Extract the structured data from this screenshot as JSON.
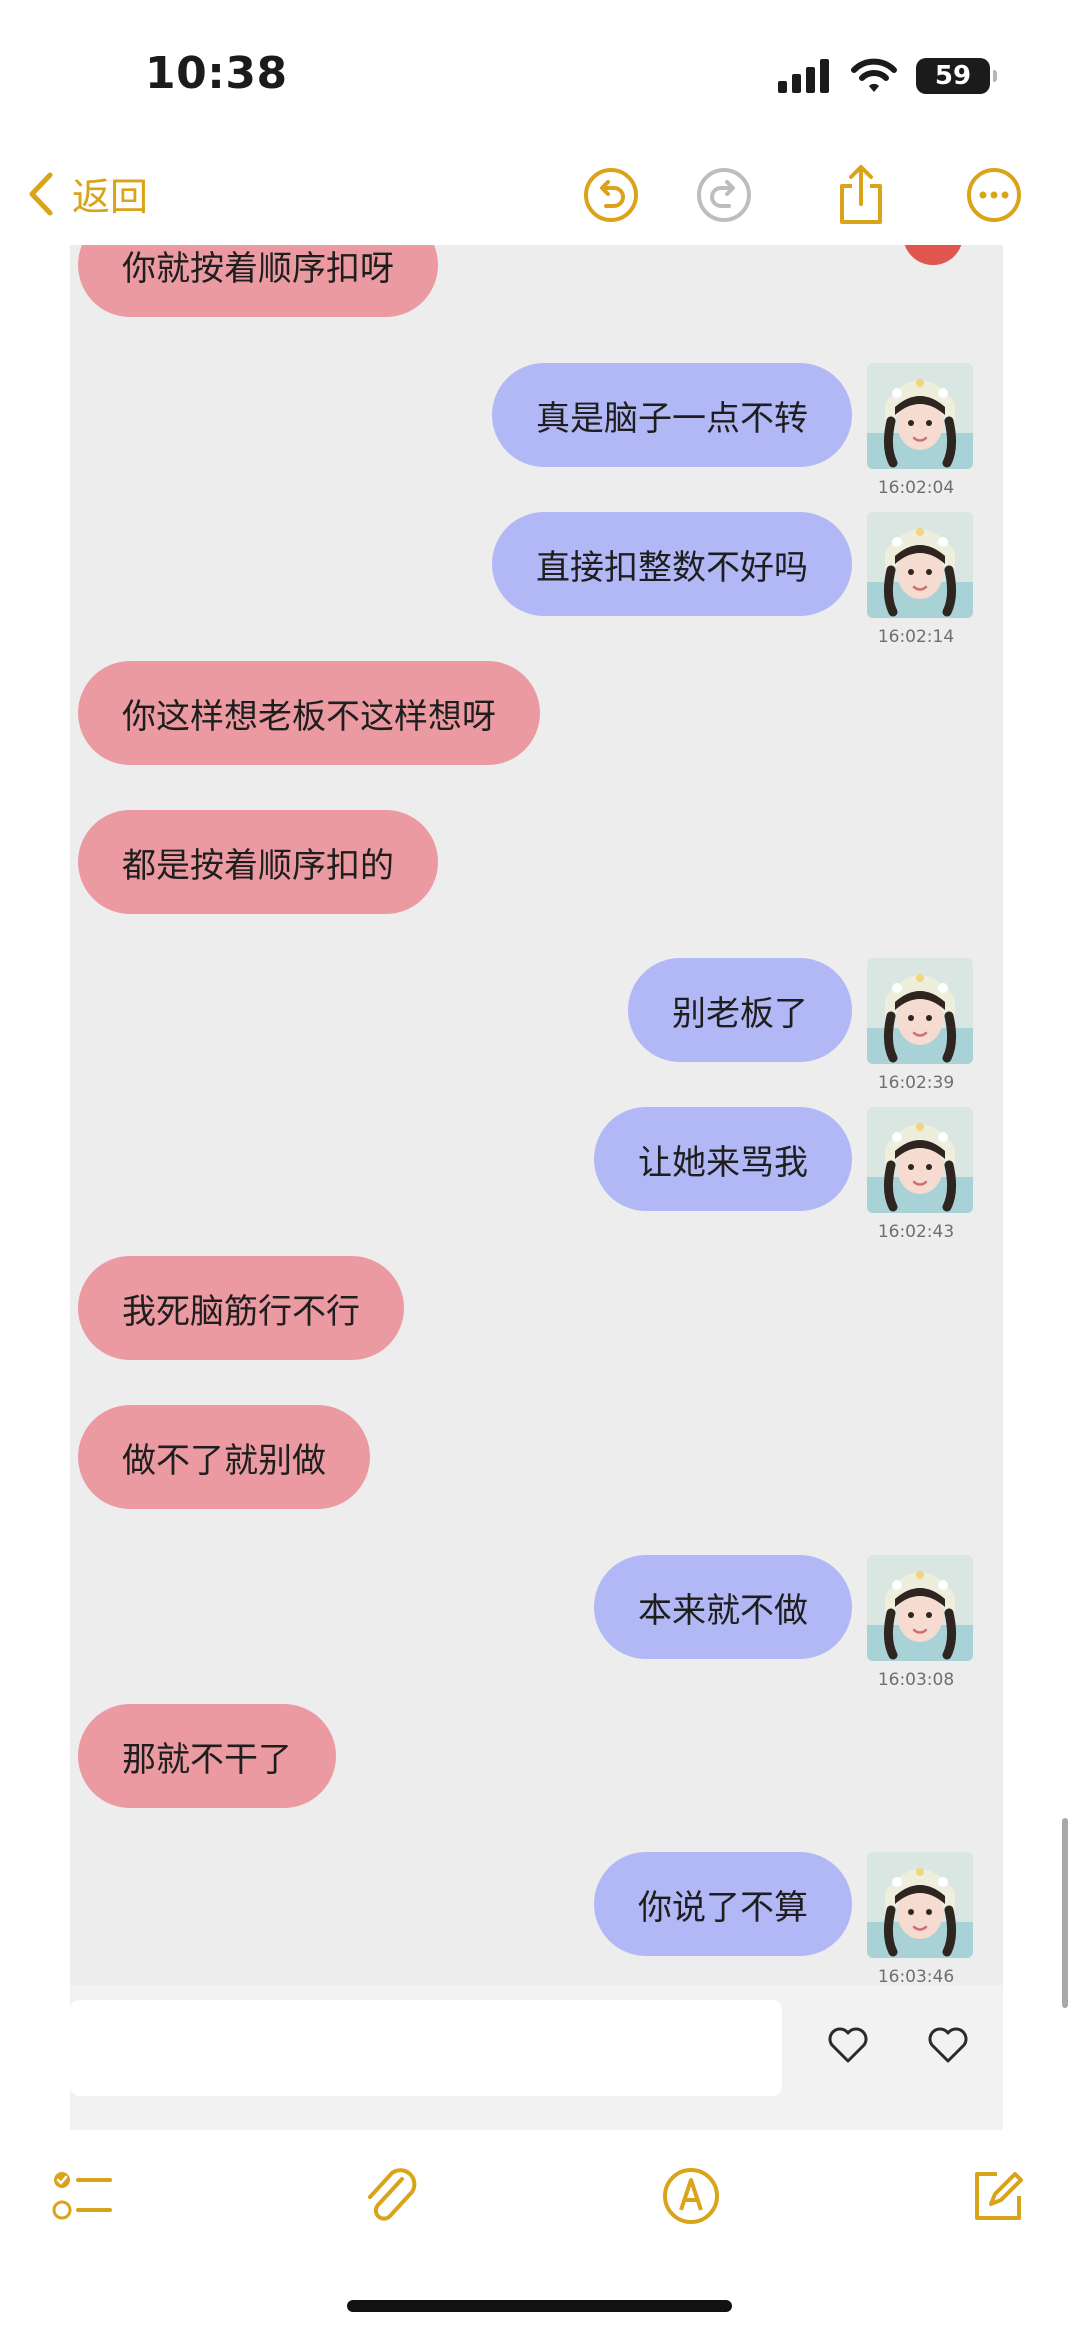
{
  "status_bar": {
    "time": "10:38",
    "battery": "59"
  },
  "nav": {
    "back_label": "返回"
  },
  "chat": [
    {
      "side": "left",
      "text": "你就按着顺序扣呀"
    },
    {
      "side": "right",
      "text": "真是脑子一点不转",
      "time": "16:02:04"
    },
    {
      "side": "right",
      "text": "直接扣整数不好吗",
      "time": "16:02:14"
    },
    {
      "side": "left",
      "text": "你这样想老板不这样想呀"
    },
    {
      "side": "left",
      "text": "都是按着顺序扣的"
    },
    {
      "side": "right",
      "text": "别老板了",
      "time": "16:02:39"
    },
    {
      "side": "right",
      "text": "让她来骂我",
      "time": "16:02:43"
    },
    {
      "side": "left",
      "text": "我死脑筋行不行"
    },
    {
      "side": "left",
      "text": "做不了就别做"
    },
    {
      "side": "right",
      "text": "本来就不做",
      "time": "16:03:08"
    },
    {
      "side": "left",
      "text": "那就不干了"
    },
    {
      "side": "right",
      "text": "你说了不算",
      "time": "16:03:46"
    }
  ],
  "colors": {
    "accent": "#d9a31a",
    "left_bubble": "#ec9aa2",
    "right_bubble": "#b2b7f5",
    "chat_bg": "#ededed"
  },
  "icons": {
    "top": [
      "chevron-left-icon",
      "undo-icon",
      "redo-icon",
      "share-icon",
      "more-icon"
    ],
    "bottom": [
      "checklist-icon",
      "attachment-icon",
      "markup-icon",
      "compose-icon"
    ]
  }
}
